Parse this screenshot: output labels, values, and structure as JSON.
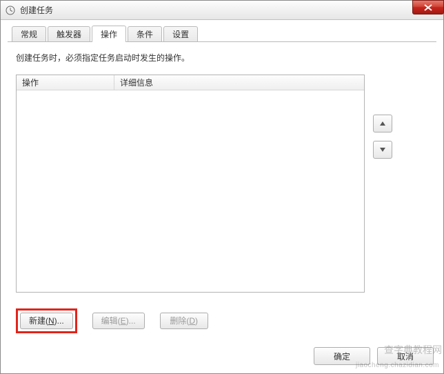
{
  "window": {
    "title": "创建任务"
  },
  "tabs": [
    {
      "label": "常规"
    },
    {
      "label": "触发器"
    },
    {
      "label": "操作",
      "active": true
    },
    {
      "label": "条件"
    },
    {
      "label": "设置"
    }
  ],
  "panel": {
    "description": "创建任务时，必须指定任务启动时发生的操作。",
    "columns": {
      "action": "操作",
      "details": "详细信息"
    }
  },
  "actions": {
    "new_prefix": "新建(",
    "new_key": "N",
    "new_suffix": ")...",
    "edit_prefix": "编辑(",
    "edit_key": "E",
    "edit_suffix": ")...",
    "delete_prefix": "删除(",
    "delete_key": "D",
    "delete_suffix": ")"
  },
  "dialog": {
    "ok": "确定",
    "cancel": "取消"
  },
  "watermark": {
    "line1": "查字典教程网",
    "line2": "jiaocheng.chazidian.com"
  }
}
